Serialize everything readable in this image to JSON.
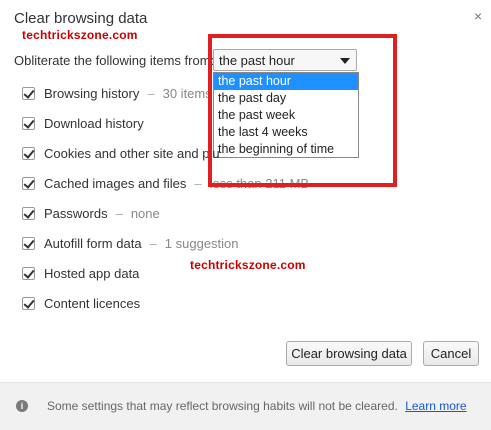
{
  "dialog": {
    "title": "Clear browsing data",
    "close_glyph": "×"
  },
  "watermark": {
    "text_top": "techtrickszone.com",
    "text_middle": "techtrickszone.com"
  },
  "range": {
    "label": "Obliterate the following items from:",
    "selected": "the past hour",
    "options": [
      "the past hour",
      "the past day",
      "the past week",
      "the last 4 weeks",
      "the beginning of time"
    ]
  },
  "items": [
    {
      "label": "Browsing history",
      "detail": "30 items",
      "checked": true
    },
    {
      "label": "Download history",
      "detail": "",
      "checked": true
    },
    {
      "label": "Cookies and other site and plu",
      "detail": "",
      "checked": true
    },
    {
      "label": "Cached images and files",
      "detail": "less than 211 MB",
      "checked": true
    },
    {
      "label": "Passwords",
      "detail": "none",
      "checked": true
    },
    {
      "label": "Autofill form data",
      "detail": "1 suggestion",
      "checked": true
    },
    {
      "label": "Hosted app data",
      "detail": "",
      "checked": true
    },
    {
      "label": "Content licences",
      "detail": "",
      "checked": true
    }
  ],
  "buttons": {
    "clear": "Clear browsing data",
    "cancel": "Cancel"
  },
  "footer": {
    "info_glyph": "i",
    "text": "Some settings that may reflect browsing habits will not be cleared.",
    "link": "Learn more"
  },
  "colors": {
    "highlight_box": "#e02020",
    "selected_option": "#1e90ff",
    "watermark": "#cc0000",
    "link": "#1558d6"
  },
  "icons": [
    "close-icon",
    "dropdown-arrow-icon",
    "checkbox-checked-icon",
    "info-icon"
  ]
}
